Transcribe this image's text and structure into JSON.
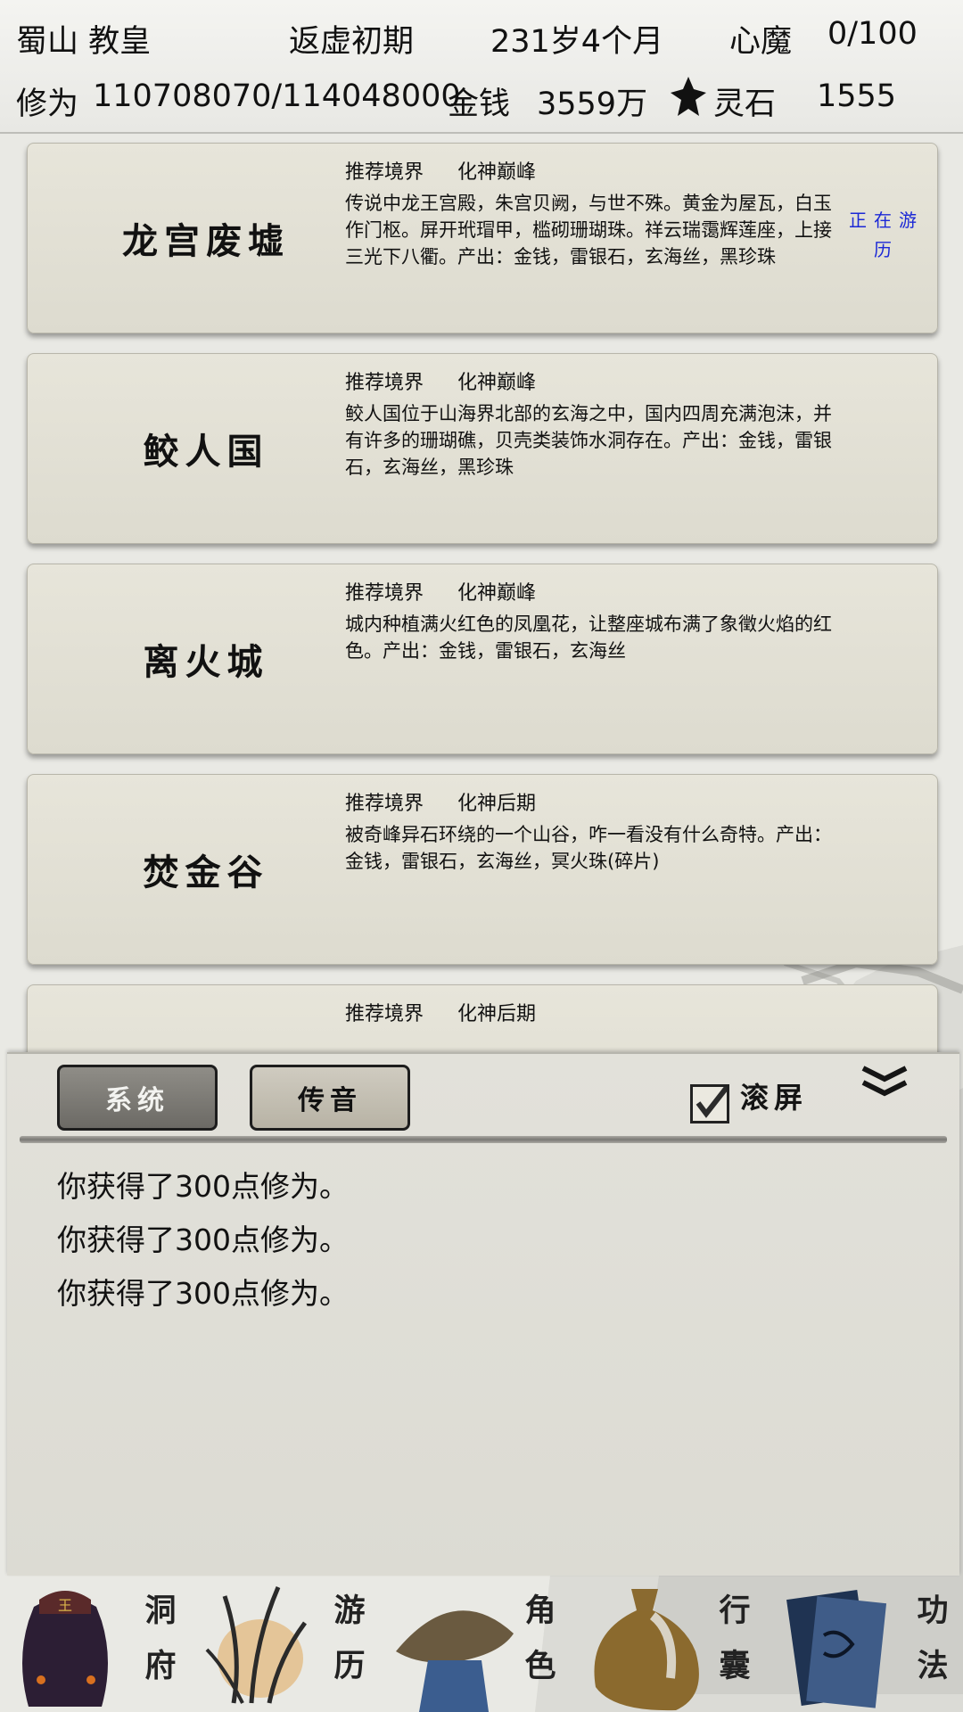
{
  "header": {
    "player": "蜀山 教皇",
    "realm": "返虚初期",
    "age": "231岁4个月",
    "demon_label": "心魔",
    "demon_value": "0/100",
    "cultivation_label": "修为",
    "cultivation_value": "110708070/114048000",
    "money_label": "金钱",
    "money_value": "3559万",
    "spirit_label": "灵石",
    "spirit_value": "1555"
  },
  "locations": [
    {
      "name": "龙宫废墟",
      "rec_label": "推荐境界",
      "rec_value": "化神巅峰",
      "desc": "传说中龙王宫殿，朱宫贝阙，与世不殊。黄金为屋瓦，白玉作门枢。屏开玳瑁甲，槛砌珊瑚珠。祥云瑞霭辉莲座，上接三光下八衢。产出：金钱，雷银石，玄海丝，黑珍珠",
      "status": "正在游历"
    },
    {
      "name": "鲛人国",
      "rec_label": "推荐境界",
      "rec_value": "化神巅峰",
      "desc": "鲛人国位于山海界北部的玄海之中，国内四周充满泡沫，并有许多的珊瑚礁，贝壳类装饰水洞存在。产出：金钱，雷银石，玄海丝，黑珍珠",
      "status": ""
    },
    {
      "name": "离火城",
      "rec_label": "推荐境界",
      "rec_value": "化神巅峰",
      "desc": "城内种植满火红色的凤凰花，让整座城布满了象徵火焰的红色。产出：金钱，雷银石，玄海丝",
      "status": ""
    },
    {
      "name": "焚金谷",
      "rec_label": "推荐境界",
      "rec_value": "化神后期",
      "desc": "被奇峰异石环绕的一个山谷，咋一看没有什么奇特。产出：金钱，雷银石，玄海丝，冥火珠(碎片)",
      "status": ""
    },
    {
      "name": "",
      "rec_label": "推荐境界",
      "rec_value": "化神后期",
      "desc": "",
      "status": ""
    }
  ],
  "panel": {
    "tab_system": "系统",
    "tab_voice": "传音",
    "scroll_label": "滚屏",
    "scroll_checked": true,
    "messages": [
      "你获得了300点修为。",
      "你获得了300点修为。",
      "你获得了300点修为。"
    ]
  },
  "nav": [
    {
      "label": "洞府",
      "icon": "treasure-bag-icon"
    },
    {
      "label": "游历",
      "icon": "grass-icon"
    },
    {
      "label": "角色",
      "icon": "straw-hat-icon"
    },
    {
      "label": "行囊",
      "icon": "cloth-bag-icon"
    },
    {
      "label": "功法",
      "icon": "scroll-book-icon"
    }
  ],
  "colors": {
    "status_blue": "#1b28d6",
    "card_bg": "#e3e1d6",
    "tab_active": "#7d7b76"
  }
}
